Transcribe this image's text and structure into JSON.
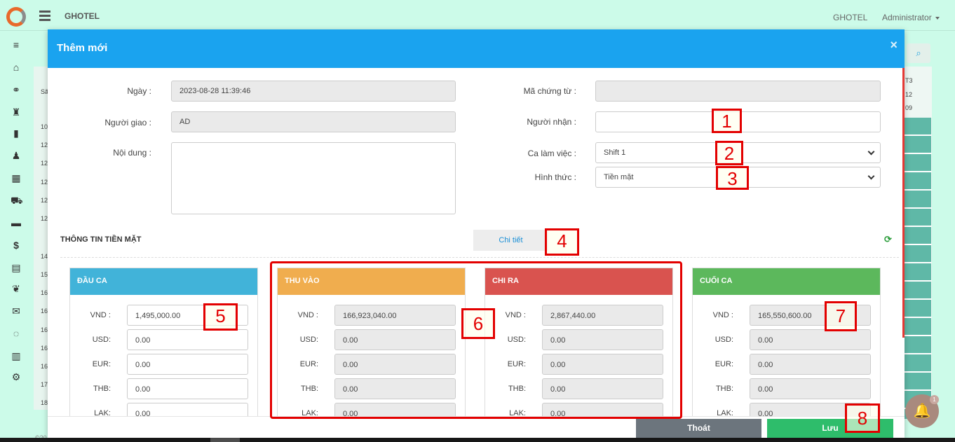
{
  "app": {
    "brand": "GHOTEL",
    "hotel_menu": "GHOTEL",
    "user_menu": "Administrator"
  },
  "sidebar": {
    "icons": [
      "menu-icon",
      "home-icon",
      "handshake-icon",
      "reception-icon",
      "building-icon",
      "users-icon",
      "grid-icon",
      "cart-icon",
      "coffee-icon",
      "dollar-icon",
      "table-icon",
      "leaf-icon",
      "mail-icon",
      "chat-icon",
      "chart-icon",
      "settings-icon"
    ]
  },
  "background": {
    "left_col_label": "Sã",
    "left_numbers": [
      "10",
      "12",
      "12",
      "12",
      "12",
      "12",
      "14",
      "15",
      "16",
      "16",
      "16",
      "16",
      "16",
      "17",
      "18"
    ],
    "right_labels": [
      "T3",
      "12",
      "09"
    ],
    "footer_text": "©20"
  },
  "modal": {
    "title": "Thêm mới",
    "close_glyph": "×",
    "fields": {
      "ngay_label": "Ngày :",
      "ngay_value": "2023-08-28  11:39:46",
      "nguoi_giao_label": "Người giao :",
      "nguoi_giao_value": "AD",
      "noi_dung_label": "Nội dung :",
      "ma_chung_tu_label": "Mã chứng từ :",
      "nguoi_nhan_label": "Người nhận :",
      "ca_lam_viec_label": "Ca làm việc :",
      "ca_lam_viec_value": "Shift 1",
      "hinh_thuc_label": "Hình thức :",
      "hinh_thuc_value": "Tiền mặt"
    },
    "section_title": "THÔNG TIN TIỀN MẶT",
    "detail_tab": "Chi tiết",
    "cards": [
      {
        "title": "ĐẦU CA",
        "color": "#41b3d9",
        "readonly": false,
        "rows": [
          {
            "label": "VND :",
            "value": "1,495,000.00"
          },
          {
            "label": "USD:",
            "value": "0.00"
          },
          {
            "label": "EUR:",
            "value": "0.00"
          },
          {
            "label": "THB:",
            "value": "0.00"
          },
          {
            "label": "LAK:",
            "value": "0.00"
          }
        ]
      },
      {
        "title": "THU VÀO",
        "color": "#f0ad4e",
        "readonly": true,
        "rows": [
          {
            "label": "VND :",
            "value": "166,923,040.00"
          },
          {
            "label": "USD:",
            "value": "0.00"
          },
          {
            "label": "EUR:",
            "value": "0.00"
          },
          {
            "label": "THB:",
            "value": "0.00"
          },
          {
            "label": "LAK:",
            "value": "0.00"
          }
        ]
      },
      {
        "title": "CHI RA",
        "color": "#d9534f",
        "readonly": true,
        "rows": [
          {
            "label": "VND :",
            "value": "2,867,440.00"
          },
          {
            "label": "USD:",
            "value": "0.00"
          },
          {
            "label": "EUR:",
            "value": "0.00"
          },
          {
            "label": "THB:",
            "value": "0.00"
          },
          {
            "label": "LAK:",
            "value": "0.00"
          }
        ]
      },
      {
        "title": "CUỐI CA",
        "color": "#5cb85c",
        "readonly": true,
        "rows": [
          {
            "label": "VND :",
            "value": "165,550,600.00"
          },
          {
            "label": "USD:",
            "value": "0.00"
          },
          {
            "label": "EUR:",
            "value": "0.00"
          },
          {
            "label": "THB:",
            "value": "0.00"
          },
          {
            "label": "LAK:",
            "value": "0.00"
          }
        ]
      }
    ],
    "buttons": {
      "exit": "Thoát",
      "save": "Lưu"
    }
  },
  "notification": {
    "badge": "1"
  },
  "annotations": [
    "1",
    "2",
    "3",
    "4",
    "5",
    "6",
    "7",
    "8"
  ]
}
